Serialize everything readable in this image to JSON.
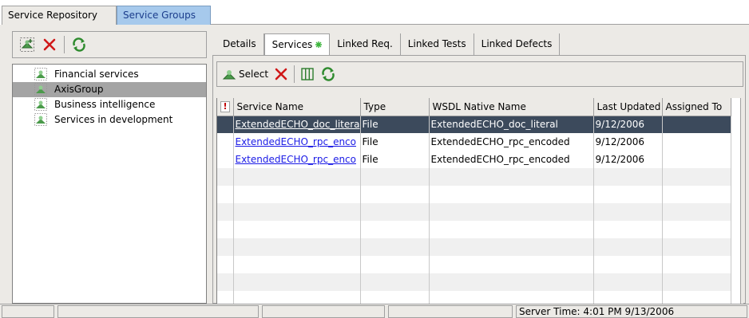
{
  "top_tabs": [
    "Service Repository",
    "Service Groups"
  ],
  "left_toolbar": {
    "icons": [
      "new-group-icon",
      "delete-icon",
      "refresh-icon"
    ]
  },
  "tree": {
    "items": [
      {
        "label": "Financial services",
        "selected": false
      },
      {
        "label": "AxisGroup",
        "selected": true
      },
      {
        "label": "Business intelligence",
        "selected": false
      },
      {
        "label": "Services in development",
        "selected": false
      }
    ]
  },
  "sub_tabs": [
    "Details",
    "Services",
    "Linked Req.",
    "Linked Tests",
    "Linked Defects"
  ],
  "right_toolbar": {
    "select_label": "Select",
    "icons": [
      "service-icon",
      "remove-icon",
      "columns-icon",
      "refresh-icon"
    ]
  },
  "grid": {
    "flag_header": "!",
    "columns": [
      "Service Name",
      "Type",
      "WSDL Native Name",
      "Last Updated",
      "Assigned To"
    ],
    "rows": [
      [
        "ExtendedECHO_doc_litera",
        "File",
        "ExtendedECHO_doc_literal",
        "9/12/2006",
        ""
      ],
      [
        "ExtendedECHO_rpc_enco",
        "File",
        "ExtendedECHO_rpc_encoded",
        "9/12/2006",
        ""
      ],
      [
        "ExtendedECHO_rpc_enco",
        "File",
        "ExtendedECHO_rpc_encoded",
        "9/12/2006",
        ""
      ]
    ],
    "selected_row": 0
  },
  "status_bar": {
    "server_time": "Server Time: 4:01 PM 9/13/2006"
  },
  "colors": {
    "selected_tab": "#a6c9ec",
    "selected_row": "#3c4a5c",
    "link": "#1a1ae6",
    "chrome": "#eceae6"
  }
}
